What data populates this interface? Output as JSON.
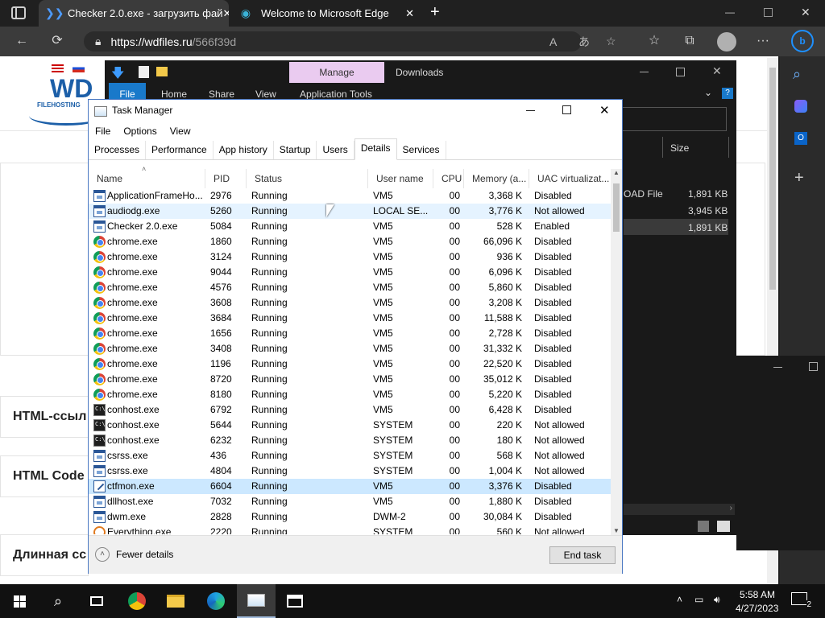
{
  "browser": {
    "tabs": [
      {
        "title": "Checker 2.0.exe - загрузить фай",
        "active": true
      },
      {
        "title": "Welcome to Microsoft Edge",
        "active": false
      }
    ],
    "new_tab": "+",
    "url_host": "https://wdfiles.ru",
    "url_path": "/566f39d",
    "window_controls": {
      "minimize": "—",
      "maximize": "▢",
      "close": "✕"
    },
    "nav": {
      "back": "←",
      "refresh": "⟳",
      "more": "···"
    }
  },
  "webpage": {
    "logo_text": "WD",
    "logo_sub": "FILEHOSTING",
    "buttons": [
      "HTML-ссыл",
      "HTML Code",
      "Длинная сс"
    ]
  },
  "explorer": {
    "manage": "Manage",
    "downloads": "Downloads",
    "ribbon": [
      "File",
      "Home",
      "Share",
      "View",
      "Application Tools"
    ],
    "size_header": "Size",
    "files": [
      {
        "type": "OAD File",
        "size": "1,891 KB"
      },
      {
        "type": "",
        "size": "3,945 KB"
      },
      {
        "type": "",
        "size": "1,891 KB"
      }
    ]
  },
  "taskmanager": {
    "title": "Task Manager",
    "menu": [
      "File",
      "Options",
      "View"
    ],
    "tabs": [
      "Processes",
      "Performance",
      "App history",
      "Startup",
      "Users",
      "Details",
      "Services"
    ],
    "active_tab": "Details",
    "columns": {
      "name": "Name",
      "pid": "PID",
      "status": "Status",
      "user": "User name",
      "cpu": "CPU",
      "memory": "Memory (a...",
      "uac": "UAC virtualizat..."
    },
    "rows": [
      {
        "icon": "app",
        "name": "ApplicationFrameHo...",
        "pid": "2976",
        "status": "Running",
        "user": "VM5",
        "cpu": "00",
        "mem": "3,368 K",
        "uac": "Disabled"
      },
      {
        "icon": "app",
        "name": "audiodg.exe",
        "pid": "5260",
        "status": "Running",
        "user": "LOCAL SE...",
        "cpu": "00",
        "mem": "3,776 K",
        "uac": "Not allowed"
      },
      {
        "icon": "app",
        "name": "Checker 2.0.exe",
        "pid": "5084",
        "status": "Running",
        "user": "VM5",
        "cpu": "00",
        "mem": "528 K",
        "uac": "Enabled"
      },
      {
        "icon": "chrome",
        "name": "chrome.exe",
        "pid": "1860",
        "status": "Running",
        "user": "VM5",
        "cpu": "00",
        "mem": "66,096 K",
        "uac": "Disabled"
      },
      {
        "icon": "chrome",
        "name": "chrome.exe",
        "pid": "3124",
        "status": "Running",
        "user": "VM5",
        "cpu": "00",
        "mem": "936 K",
        "uac": "Disabled"
      },
      {
        "icon": "chrome",
        "name": "chrome.exe",
        "pid": "9044",
        "status": "Running",
        "user": "VM5",
        "cpu": "00",
        "mem": "6,096 K",
        "uac": "Disabled"
      },
      {
        "icon": "chrome",
        "name": "chrome.exe",
        "pid": "4576",
        "status": "Running",
        "user": "VM5",
        "cpu": "00",
        "mem": "5,860 K",
        "uac": "Disabled"
      },
      {
        "icon": "chrome",
        "name": "chrome.exe",
        "pid": "3608",
        "status": "Running",
        "user": "VM5",
        "cpu": "00",
        "mem": "3,208 K",
        "uac": "Disabled"
      },
      {
        "icon": "chrome",
        "name": "chrome.exe",
        "pid": "3684",
        "status": "Running",
        "user": "VM5",
        "cpu": "00",
        "mem": "11,588 K",
        "uac": "Disabled"
      },
      {
        "icon": "chrome",
        "name": "chrome.exe",
        "pid": "1656",
        "status": "Running",
        "user": "VM5",
        "cpu": "00",
        "mem": "2,728 K",
        "uac": "Disabled"
      },
      {
        "icon": "chrome",
        "name": "chrome.exe",
        "pid": "3408",
        "status": "Running",
        "user": "VM5",
        "cpu": "00",
        "mem": "31,332 K",
        "uac": "Disabled"
      },
      {
        "icon": "chrome",
        "name": "chrome.exe",
        "pid": "1196",
        "status": "Running",
        "user": "VM5",
        "cpu": "00",
        "mem": "22,520 K",
        "uac": "Disabled"
      },
      {
        "icon": "chrome",
        "name": "chrome.exe",
        "pid": "8720",
        "status": "Running",
        "user": "VM5",
        "cpu": "00",
        "mem": "35,012 K",
        "uac": "Disabled"
      },
      {
        "icon": "chrome",
        "name": "chrome.exe",
        "pid": "8180",
        "status": "Running",
        "user": "VM5",
        "cpu": "00",
        "mem": "5,220 K",
        "uac": "Disabled"
      },
      {
        "icon": "con",
        "name": "conhost.exe",
        "pid": "6792",
        "status": "Running",
        "user": "VM5",
        "cpu": "00",
        "mem": "6,428 K",
        "uac": "Disabled"
      },
      {
        "icon": "con",
        "name": "conhost.exe",
        "pid": "5644",
        "status": "Running",
        "user": "SYSTEM",
        "cpu": "00",
        "mem": "220 K",
        "uac": "Not allowed"
      },
      {
        "icon": "con",
        "name": "conhost.exe",
        "pid": "6232",
        "status": "Running",
        "user": "SYSTEM",
        "cpu": "00",
        "mem": "180 K",
        "uac": "Not allowed"
      },
      {
        "icon": "app",
        "name": "csrss.exe",
        "pid": "436",
        "status": "Running",
        "user": "SYSTEM",
        "cpu": "00",
        "mem": "568 K",
        "uac": "Not allowed"
      },
      {
        "icon": "app",
        "name": "csrss.exe",
        "pid": "4804",
        "status": "Running",
        "user": "SYSTEM",
        "cpu": "00",
        "mem": "1,004 K",
        "uac": "Not allowed"
      },
      {
        "icon": "ctf",
        "name": "ctfmon.exe",
        "pid": "6604",
        "status": "Running",
        "user": "VM5",
        "cpu": "00",
        "mem": "3,376 K",
        "uac": "Disabled",
        "selected": true
      },
      {
        "icon": "app",
        "name": "dllhost.exe",
        "pid": "7032",
        "status": "Running",
        "user": "VM5",
        "cpu": "00",
        "mem": "1,880 K",
        "uac": "Disabled"
      },
      {
        "icon": "app",
        "name": "dwm.exe",
        "pid": "2828",
        "status": "Running",
        "user": "DWM-2",
        "cpu": "00",
        "mem": "30,084 K",
        "uac": "Disabled"
      },
      {
        "icon": "ev",
        "name": "Everything.exe",
        "pid": "2220",
        "status": "Running",
        "user": "SYSTEM",
        "cpu": "00",
        "mem": "560 K",
        "uac": "Not allowed"
      }
    ],
    "fewer_details": "Fewer details",
    "end_task": "End task"
  },
  "taskbar": {
    "time": "5:58 AM",
    "date": "4/27/2023",
    "notif_count": "2"
  }
}
